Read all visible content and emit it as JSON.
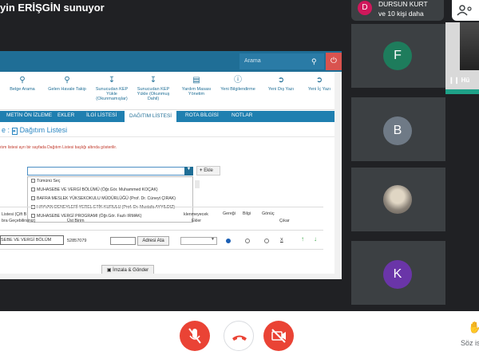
{
  "meeting": {
    "presenter_text": "yin ERİŞGİN sunuyor",
    "participants_line1": "DURSUN KURT",
    "participants_line2": "ve 10 kişi daha",
    "first_avatar_letter": "D",
    "cam_label": "Hü"
  },
  "ebys": {
    "search_placeholder": "Arama",
    "toolbar": [
      {
        "label": "Belge Arama",
        "icon": "search-icon"
      },
      {
        "label": "Gelen Havale Takip",
        "icon": "search-icon"
      },
      {
        "label": "Sunucudan KEP Yükle (Okunmamışlar)",
        "icon": "download-icon"
      },
      {
        "label": "Sunucudan KEP Yükle (Okunmuş Dahil)",
        "icon": "download-icon"
      },
      {
        "label": "Yardım Masası Yönetim",
        "icon": "document-icon"
      },
      {
        "label": "Yeni Bilgilendirme",
        "icon": "info-icon"
      },
      {
        "label": "Yeni Dış Yazı",
        "icon": "export-icon"
      },
      {
        "label": "Yeni İç Yazı",
        "icon": "import-icon"
      }
    ],
    "tabs": [
      "METİN ÖN İZLEME",
      "EKLER",
      "İLGİ LİSTESİ",
      "DAĞITIM LİSTESİ",
      "ROTA BİLGİSİ",
      "NOTLAR"
    ],
    "page_title": "Dağıtım Listesi",
    "page_title_prefix": "e :",
    "note": "ıtım listesi ayrı bir sayfada Dağıtım Listesi başlığı altında gösterilir.",
    "ekle_label": "Ekle",
    "dropdown_items": [
      "Tümünü Seç",
      "MUHASEBE VE VERGİ BÖLÜMÜ (Öğr.Gör. Muhammed KOÇAK)",
      "BAFRA MESLEK YÜKSEKOKULU MÜDÜRLÜĞÜ (Prof. Dr. Cüneyt ÇIRAK)",
      "HAYVAN DENEYLERİ YEREL ETİK KURULU (Prof. Dr. Mustafa AYYILDIZ)",
      "MUHASEBE VERGİ PROGRAMI (Öğr.Gör. Fazlı IRMAK)"
    ],
    "columns": {
      "liste": "Listesi (Çift B",
      "liste2": "bra Geçebilirsiniz)",
      "ust_birim": "Üst Birim",
      "eklenmeyecek": "klenmeyecek",
      "ekler": "Ekler",
      "geregi": "Gereği",
      "bilgi": "Bilgi",
      "gizlilik": "Gönüç",
      "cikar": "Çıkar"
    },
    "row": {
      "unit": "SEBE VE VERGİ BÖLÜM",
      "ust_birim_code": "52857079",
      "adresi_btn": "Adresi Ata",
      "remove": "X"
    },
    "imzala": "İmzala & Gönder"
  },
  "tiles": [
    {
      "letter": "F",
      "color": "#1e7c5c"
    },
    {
      "letter": "B",
      "color": "#6f7a86"
    },
    {
      "letter": "",
      "color": "#9e9e9e"
    },
    {
      "letter": "K",
      "color": "#6a35a8"
    }
  ],
  "bottom": {
    "soz_label": "Söz is"
  }
}
